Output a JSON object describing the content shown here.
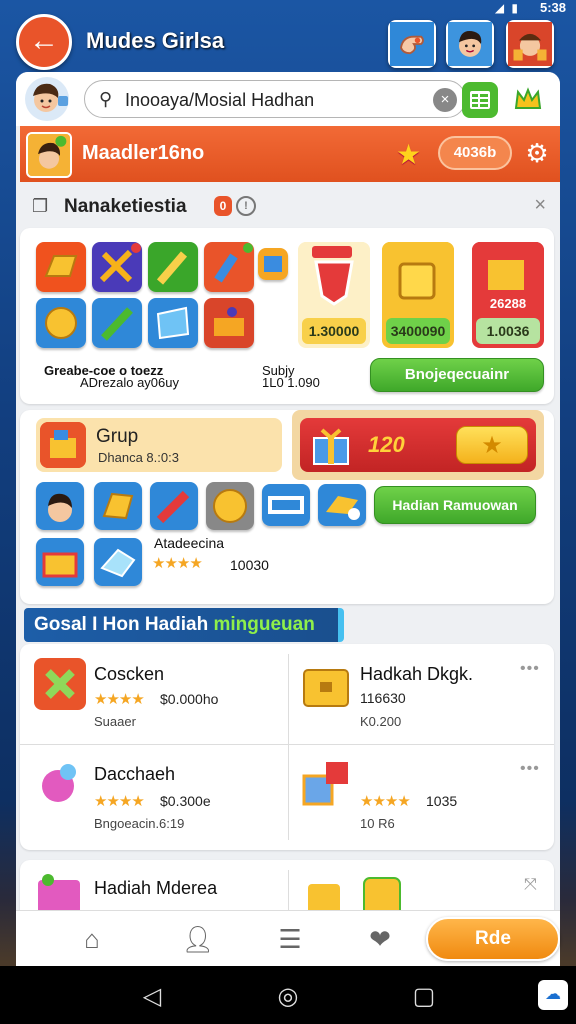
{
  "status": {
    "time": "5:38",
    "icons": "◢ ▮"
  },
  "header": {
    "title": "Mudes Girlsa",
    "back_glyph": "←"
  },
  "search": {
    "placeholder": "Inooaya/Mosial Hadhan",
    "cancel_glyph": "×"
  },
  "orange_bar": {
    "title": "Maadler16no",
    "points": "4036b"
  },
  "section": {
    "title": "Nanaketiestia",
    "badge": "0",
    "close_glyph": "×"
  },
  "rewards_card": {
    "caption": "Greabe-coe o toezz",
    "caption_sub": "ADrezalo ay06uy",
    "mid_label": "Subjy",
    "mid_value": "1L0 1.090",
    "prizes": [
      "1.30000",
      "3400090",
      "1.0036",
      "26288"
    ],
    "button": "Bnojeqecuainr"
  },
  "group_card": {
    "title": "Grup",
    "sub": "Dhanca  8.:0:3",
    "amount": "120",
    "button": "Hadian Ramuowan",
    "label": "Atadeecina",
    "rating_value": "10030"
  },
  "weekly_banner": {
    "part1": "Gosal I Hon Hadiah",
    "part2": "mingueuan"
  },
  "list": [
    {
      "name": "Coscken",
      "meta": "$0.000ho",
      "sub": "Suaaer"
    },
    {
      "name": "Hadkah Dkgk.",
      "meta": "116630",
      "sub": "K0.200"
    },
    {
      "name": "Dacchaeh",
      "meta": "$0.300e",
      "sub": "Bngoeacin.6:19"
    },
    {
      "name": "",
      "meta": "1035",
      "sub": "10 R6"
    },
    {
      "name": "Hadiah Mderea",
      "meta": "",
      "sub": ""
    }
  ],
  "navbar": {
    "ride_label": "Rde"
  },
  "icons": {
    "back": "arrow-left-icon",
    "search": "search-icon",
    "gear": "gear-icon",
    "star": "star-icon",
    "home": "home-icon",
    "profile": "profile-icon",
    "list": "list-icon",
    "gift": "gift-icon"
  },
  "colors": {
    "accent": "#e9542a",
    "green": "#4cba2f",
    "gold": "#f5a623",
    "background": "#123f80"
  }
}
